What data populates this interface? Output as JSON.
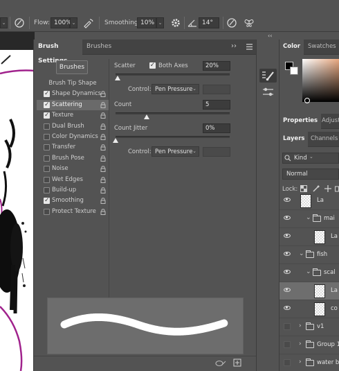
{
  "options_bar": {
    "flow_label": "Flow:",
    "flow_value": "100%",
    "smoothing_label": "Smoothing:",
    "smoothing_value": "10%",
    "angle_value": "14°"
  },
  "brush_panel": {
    "tabs": [
      {
        "label": "Brush Settings",
        "active": true
      },
      {
        "label": "Brushes",
        "active": false
      }
    ],
    "brushes_button": "Brushes",
    "options": [
      {
        "label": "Brush Tip Shape",
        "checkbox": false,
        "checked": false,
        "lock": false,
        "selected": false
      },
      {
        "label": "Shape Dynamics",
        "checkbox": true,
        "checked": true,
        "lock": true,
        "selected": false
      },
      {
        "label": "Scattering",
        "checkbox": true,
        "checked": true,
        "lock": true,
        "selected": true
      },
      {
        "label": "Texture",
        "checkbox": true,
        "checked": true,
        "lock": true,
        "selected": false
      },
      {
        "label": "Dual Brush",
        "checkbox": true,
        "checked": false,
        "lock": true,
        "selected": false
      },
      {
        "label": "Color Dynamics",
        "checkbox": true,
        "checked": false,
        "lock": true,
        "selected": false
      },
      {
        "label": "Transfer",
        "checkbox": true,
        "checked": false,
        "lock": true,
        "selected": false
      },
      {
        "label": "Brush Pose",
        "checkbox": true,
        "checked": false,
        "lock": true,
        "selected": false
      },
      {
        "label": "Noise",
        "checkbox": true,
        "checked": false,
        "lock": true,
        "selected": false
      },
      {
        "label": "Wet Edges",
        "checkbox": true,
        "checked": false,
        "lock": true,
        "selected": false
      },
      {
        "label": "Build-up",
        "checkbox": true,
        "checked": false,
        "lock": true,
        "selected": false
      },
      {
        "label": "Smoothing",
        "checkbox": true,
        "checked": true,
        "lock": true,
        "selected": false
      },
      {
        "label": "Protect Texture",
        "checkbox": true,
        "checked": false,
        "lock": true,
        "selected": false
      }
    ],
    "scatter": {
      "label": "Scatter",
      "both_axes_label": "Both Axes",
      "both_axes_checked": true,
      "value": "20%",
      "level": 0.02,
      "control_label": "Control:",
      "control_value": "Pen Pressure"
    },
    "count": {
      "label": "Count",
      "value": "5",
      "level": 0.27
    },
    "count_jitter": {
      "label": "Count Jitter",
      "value": "0%",
      "level": 0.0,
      "control_label": "Control:",
      "control_value": "Pen Pressure"
    }
  },
  "right_dock": {
    "color_tabs": [
      {
        "label": "Color",
        "active": true
      },
      {
        "label": "Swatches",
        "active": false
      }
    ],
    "properties_tabs": [
      {
        "label": "Properties",
        "active": true
      },
      {
        "label": "Adjust",
        "active": false
      }
    ],
    "layers_tabs": [
      {
        "label": "Layers",
        "active": true
      },
      {
        "label": "Channels",
        "active": false
      }
    ],
    "filter_kind": "Kind",
    "blend_mode": "Normal",
    "lock_label": "Lock:",
    "layers": [
      {
        "name": "La",
        "type": "layer",
        "visible": true,
        "indent": 0,
        "selected": false
      },
      {
        "name": "mai",
        "type": "group",
        "visible": true,
        "indent": 1,
        "selected": false
      },
      {
        "name": "La",
        "type": "layer",
        "visible": true,
        "indent": 2,
        "selected": false
      },
      {
        "name": "fish",
        "type": "group",
        "visible": true,
        "indent": 0,
        "selected": false
      },
      {
        "name": "scal",
        "type": "group",
        "visible": true,
        "indent": 1,
        "selected": false
      },
      {
        "name": "La",
        "type": "layer",
        "visible": true,
        "indent": 2,
        "selected": true
      },
      {
        "name": "co",
        "type": "layer",
        "visible": true,
        "indent": 2,
        "selected": false
      },
      {
        "name": "v1",
        "type": "group",
        "visible": false,
        "indent": 0,
        "selected": false
      },
      {
        "name": "Group 1",
        "type": "group",
        "visible": false,
        "indent": 0,
        "selected": false
      },
      {
        "name": "water b",
        "type": "group",
        "visible": false,
        "indent": 0,
        "selected": false
      }
    ]
  }
}
